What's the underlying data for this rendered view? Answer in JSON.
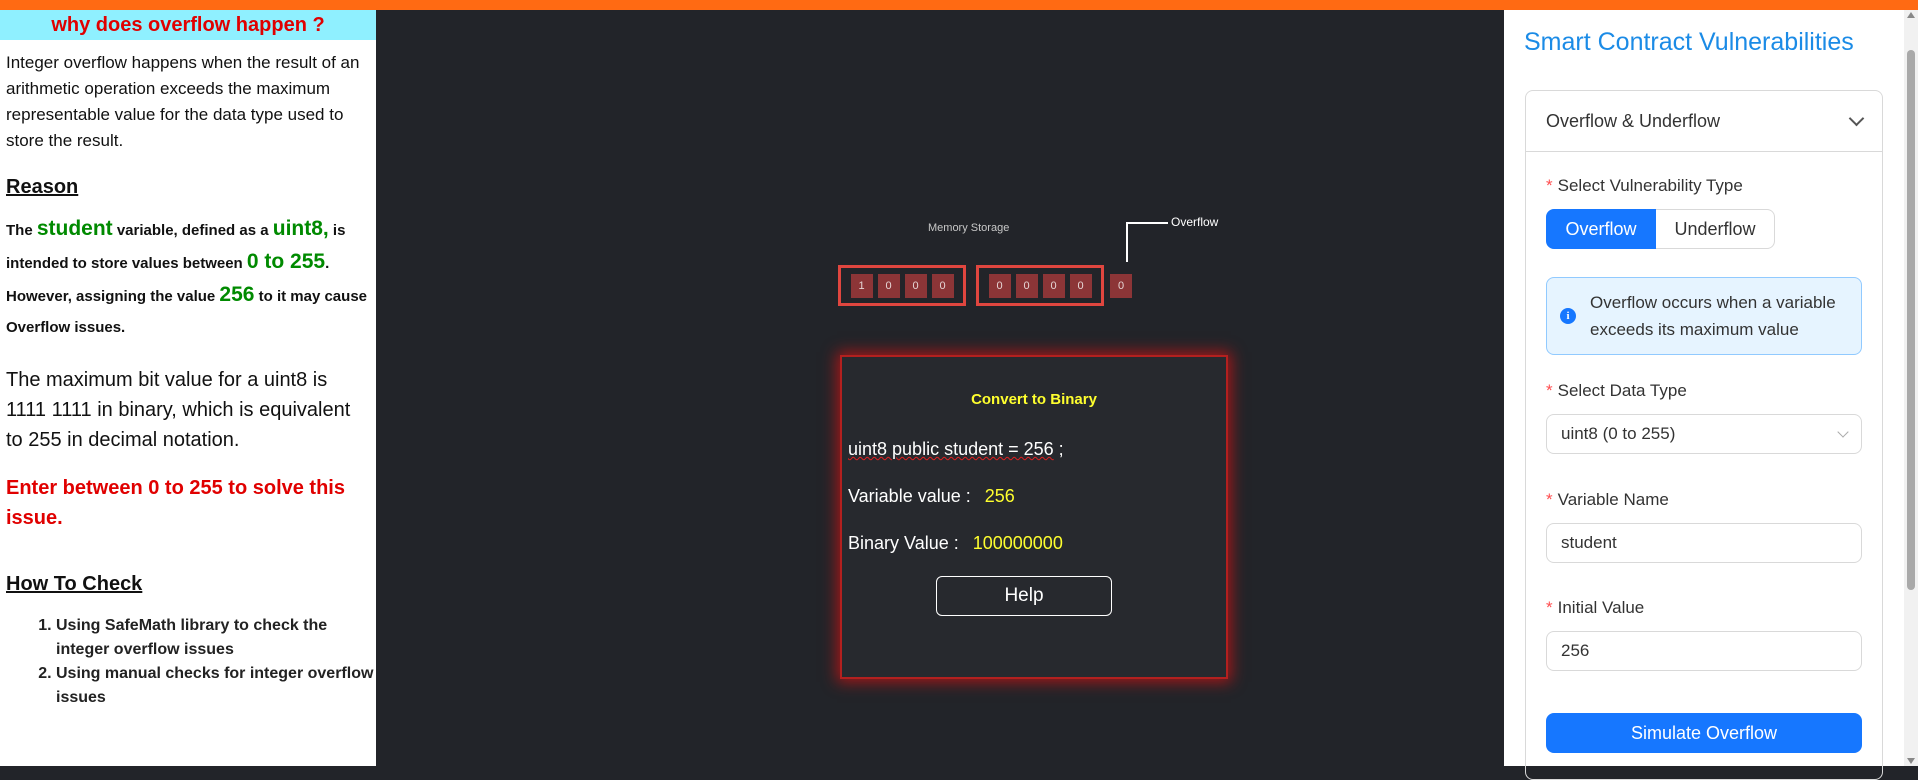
{
  "left": {
    "title": "why does overflow happen ?",
    "intro": "Integer overflow happens when the result of an arithmetic operation exceeds the maximum representable value for the data type used to store the result.",
    "reason_heading": "Reason",
    "reason": {
      "p1": "The ",
      "var": "student",
      "p2": " variable, defined as a ",
      "type": "uint8,",
      "p3": " is intended to store values between ",
      "range": "0 to 255",
      "p4": ". However, assigning the value ",
      "value": "256",
      "p5": " to it may cause Overflow issues."
    },
    "max_bit": "The maximum bit value for a uint8 is 1111 1111 in binary, which is equivalent to 255 in decimal notation.",
    "enter": "Enter between 0 to 255 to solve this issue.",
    "how_heading": "How To Check",
    "checks": [
      "Using SafeMath library to check the integer overflow issues",
      "Using manual checks for integer overflow issues"
    ]
  },
  "middle": {
    "memory_label": "Memory Storage",
    "overflow_label": "Overflow",
    "group1_bits": [
      "1",
      "0",
      "0",
      "0"
    ],
    "group2_bits": [
      "0",
      "0",
      "0",
      "0"
    ],
    "overflow_bit": "0",
    "card": {
      "title": "Convert to Binary",
      "code_decl": "uint8 public student = 256",
      "code_end": " ;",
      "variable_label": "Variable value :",
      "variable_value": "256",
      "binary_label": "Binary Value :",
      "binary_value": "100000000",
      "help_label": "Help"
    }
  },
  "right": {
    "title": "Smart Contract Vulnerabilities",
    "collapse_title": "Overflow & Underflow",
    "vuln_type_label": "Select Vulnerability Type",
    "vuln_types": [
      "Overflow",
      "Underflow"
    ],
    "alert": "Overflow occurs when a variable exceeds its maximum value",
    "data_type_label": "Select Data Type",
    "data_type_value": "uint8 (0 to 255)",
    "var_name_label": "Variable Name",
    "var_name_value": "student",
    "init_value_label": "Initial Value",
    "init_value": "256",
    "simulate_label": "Simulate Overflow"
  }
}
